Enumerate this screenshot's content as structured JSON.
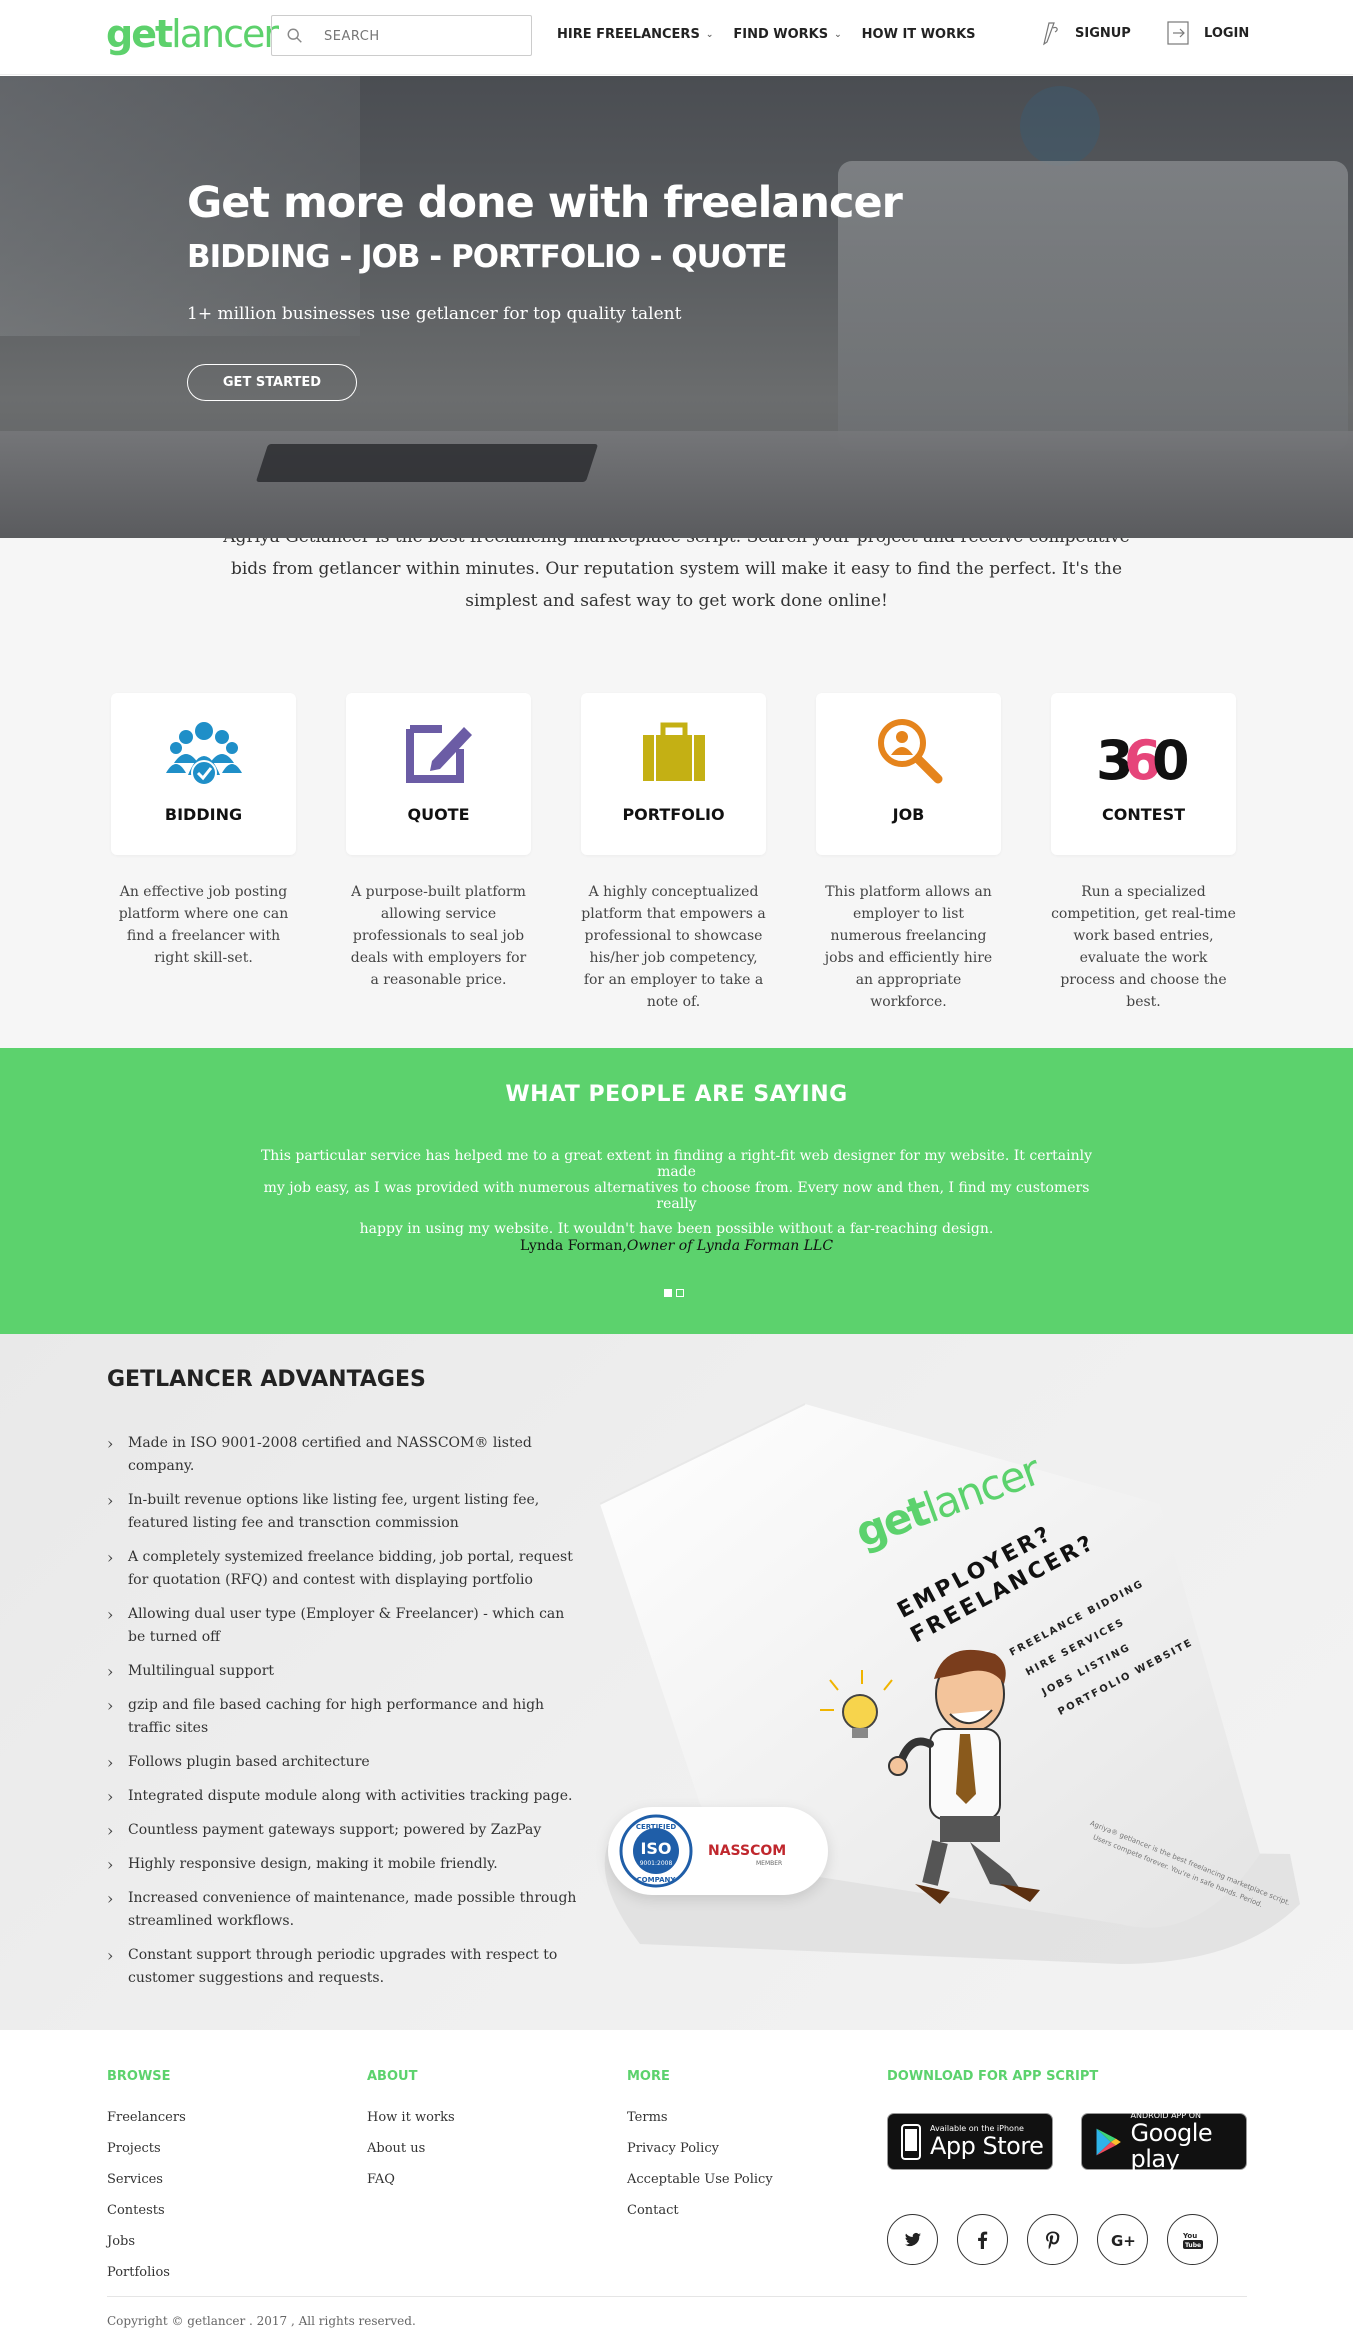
{
  "header": {
    "logo_bold": "get",
    "logo_light": "lancer",
    "search_placeholder": "SEARCH",
    "nav": [
      {
        "label": "HIRE FREELANCERS",
        "dropdown": true
      },
      {
        "label": "FIND WORKS",
        "dropdown": true
      },
      {
        "label": "HOW IT WORKS",
        "dropdown": false
      }
    ],
    "signup": "SIGNUP",
    "login": "LOGIN"
  },
  "hero": {
    "title": "Get more done with freelancer",
    "subtitle": "BIDDING - JOB - PORTFOLIO - QUOTE",
    "tagline": "1+ million businesses use getlancer for top quality talent",
    "cta": "GET STARTED"
  },
  "intro": {
    "text": "Agriya Getlancer is the best freelancing marketplace script. Search your project and receive competitive bids from getlancer within minutes. Our reputation system will make it easy to find the perfect. It's the simplest and safest way to get work done online!"
  },
  "features": [
    {
      "label": "BIDDING",
      "icon": "users-check-icon",
      "color": "#1f8fc8",
      "desc": "An effective job posting platform where one can find a freelancer with right skill-set."
    },
    {
      "label": "QUOTE",
      "icon": "edit-icon",
      "color": "#6b5ca5",
      "desc": "A purpose-built platform allowing service professionals to seal job deals with employers for a reasonable price."
    },
    {
      "label": "PORTFOLIO",
      "icon": "briefcase-icon",
      "color": "#c4b014",
      "desc": "A highly conceptualized platform that empowers a professional to showcase his/her job competency, for an employer to take a note of."
    },
    {
      "label": "JOB",
      "icon": "search-person-icon",
      "color": "#e5841c",
      "desc": "This platform allows an employer to list numerous freelancing jobs and efficiently hire an appropriate workforce."
    },
    {
      "label": "CONTEST",
      "icon": "360-icon",
      "color": "#e6457a",
      "desc": "Run a specialized competition, get real-time work based entries, evaluate the work process and choose the best."
    }
  ],
  "testimonial": {
    "heading": "WHAT PEOPLE ARE SAYING",
    "quote_line1": "This particular service has helped me to a great extent in finding a right-fit web designer for my website. It certainly made",
    "quote_line2": "my job easy, as I was provided with numerous alternatives to choose from. Every now and then, I find my customers really",
    "quote_line3": "happy in using my website. It wouldn't have been possible without a far-reaching design.",
    "author_name": "Lynda Forman,",
    "author_role": "Owner of Lynda Forman LLC",
    "slides": 2,
    "active_slide": 1
  },
  "advantages": {
    "heading": "GETLANCER ADVANTAGES",
    "items": [
      "Made in ISO 9001-2008 certified and NASSCOM® listed company.",
      "In-built revenue options like listing fee, urgent listing fee, featured listing fee and transction commission",
      "A completely systemized freelance bidding, job portal, request for quotation (RFQ) and contest with displaying portfolio",
      "Allowing dual user type (Employer & Freelancer) - which can be turned off",
      "Multilingual support",
      "gzip and file based caching for high performance and high traffic sites",
      "Follows plugin based architecture",
      "Integrated dispute module along with activities tracking page.",
      "Countless payment gateways support; powered by ZazPay",
      "Highly responsive design, making it mobile friendly.",
      "Increased convenience of maintenance, made possible through streamlined workflows.",
      "Constant support through periodic upgrades with respect to customer suggestions and requests."
    ],
    "brochure": {
      "logo_bold": "get",
      "logo_light": "lancer",
      "line1": "EMPLOYER?",
      "line2": "FREELANCER?",
      "list": [
        "FREELANCE BIDDING",
        "HIRE SERVICES",
        "JOBS LISTING",
        "PORTFOLIO WEBSITE"
      ],
      "footnote1": "Agriya® getlancer is the best freelancing marketplace script.",
      "footnote2": "Users compete forever. You're in safe hands. Period."
    },
    "cert": {
      "iso_top": "CERTIFIED",
      "iso_mid": "ISO",
      "iso_num": "9001:2008",
      "iso_bot": "COMPANY",
      "nasscom": "NASSCOM",
      "nasscom_sub": "MEMBER"
    }
  },
  "footer": {
    "browse": {
      "title": "BROWSE",
      "links": [
        "Freelancers",
        "Projects",
        "Services",
        "Contests",
        "Jobs",
        "Portfolios"
      ]
    },
    "about": {
      "title": "ABOUT",
      "links": [
        "How it works",
        "About us",
        "FAQ"
      ]
    },
    "more": {
      "title": "MORE",
      "links": [
        "Terms",
        "Privacy Policy",
        "Acceptable Use Policy",
        "Contact"
      ]
    },
    "download": {
      "title": "DOWNLOAD FOR APP SCRIPT",
      "appstore_small": "Available on the iPhone",
      "appstore_big": "App Store",
      "gplay_small": "ANDROID APP ON",
      "gplay_big": "Google play"
    },
    "social": [
      "twitter-icon",
      "facebook-icon",
      "pinterest-icon",
      "google-plus-icon",
      "youtube-icon"
    ],
    "copyright": "Copyright © getlancer . 2017 , All rights reserved."
  },
  "colors": {
    "brand_green": "#5cd26d",
    "text_dark": "#222222"
  }
}
